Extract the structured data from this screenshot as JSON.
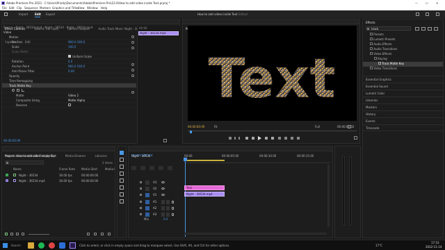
{
  "window": {
    "title": "Adobe Premiere Pro 2023 - C:\\Users\\Priody\\Documents\\Adobe\\Premiere Pro\\23.0\\How to add video inside Text.prproj *",
    "controls": [
      "—",
      "☐",
      "✕"
    ]
  },
  "menu": [
    "File",
    "Edit",
    "Clip",
    "Sequence",
    "Markers",
    "Graphics and Titles",
    "View",
    "Window",
    "Help"
  ],
  "workspace": {
    "tabs": [
      "Import",
      "Edit",
      "Export"
    ],
    "active": "Edit",
    "project_name": "How to add video inside Text",
    "edited_label": "Edited"
  },
  "source_panel": {
    "tabs": [
      "Effect Controls",
      "Source: (no clips)",
      "Lumetri Scopes",
      "Audio Track Mixer: Night - 36534",
      "Text",
      "Capture",
      "Edit"
    ],
    "header": "Source · Night - 36534.mp4 › Night - 36534 · Night - 36534.mp4",
    "section": "Video",
    "props": [
      {
        "name": "Motion",
        "value": ""
      },
      {
        "name": "Position",
        "value": "960.0   540.0"
      },
      {
        "name": "Scale",
        "value": "100.0"
      },
      {
        "name": "Scale Width",
        "value": ""
      },
      {
        "name": "",
        "value": "Uniform Scale"
      },
      {
        "name": "Rotation",
        "value": "0.0"
      },
      {
        "name": "Anchor Point",
        "value": "960.0   540.0"
      },
      {
        "name": "Anti-flicker Filter",
        "value": "0.00"
      },
      {
        "name": "Opacity",
        "value": ""
      },
      {
        "name": "Time Remapping",
        "value": ""
      },
      {
        "name": "Track Matte Key",
        "value": ""
      },
      {
        "name": "",
        "value": ""
      },
      {
        "name": "Matte",
        "value": "Video 2"
      },
      {
        "name": "Composite Using",
        "value": "Matte Alpha"
      },
      {
        "name": "Reverse",
        "value": ""
      }
    ],
    "mini_timeline_label": "00:00",
    "mini_clip": "Night - 36534.mp4",
    "timecode": "00:00:00:09"
  },
  "program": {
    "tabs": [
      "Program: Night - 36534",
      "Reference: Night - 36534",
      "Effects"
    ],
    "overlay_text": "Text",
    "timecode": "00:00:00:09",
    "fit": "Fit",
    "quality": "Full",
    "duration": "00:00:03:02"
  },
  "effects_panel": {
    "title": "Effects",
    "search": "track",
    "tree": [
      {
        "label": "Presets",
        "depth": 1
      },
      {
        "label": "Lumetri Presets",
        "depth": 1
      },
      {
        "label": "Audio Effects",
        "depth": 1
      },
      {
        "label": "Audio Transitions",
        "depth": 1
      },
      {
        "label": "Video Effects",
        "depth": 1
      },
      {
        "label": "Keying",
        "depth": 2
      },
      {
        "label": "Track Matte Key",
        "depth": 3
      },
      {
        "label": "Video Transitions",
        "depth": 1
      }
    ],
    "sections": [
      "Essential Graphics",
      "Essential Sound",
      "Lumetri Color",
      "Libraries",
      "Markers",
      "History",
      "Events",
      "Timecode"
    ]
  },
  "project_panel": {
    "tabs": [
      "Project: How to add video inside Text",
      "Media Browser",
      "Libraries"
    ],
    "path": "How to add video inside Text.prproj",
    "items_count": "2 items",
    "columns": [
      "Name",
      "Frame Rate",
      "Media Start",
      "Media E"
    ],
    "rows": [
      {
        "name": "Night - 36534",
        "fps": "30.00 fps",
        "start": "00:00:00:00",
        "color": "#3aa655"
      },
      {
        "name": "Night - 36534.mp4",
        "fps": "30.00 fps",
        "start": "00:00:00:00",
        "color": "#8d7ad9"
      }
    ]
  },
  "timeline": {
    "tab": "Night - 36534",
    "timecode": "00:00:00:09",
    "ruler": [
      "00:00",
      "00:00:05:00",
      "00:00:10:00",
      "00:00:15:00"
    ],
    "tracks_video": [
      "V3",
      "V2",
      "V1"
    ],
    "tracks_audio": [
      "A1",
      "A2",
      "A3"
    ],
    "mix": "Mix",
    "mix_value": "0.0",
    "clip_text": "Text",
    "clip_video": "Night - 36534.mp4"
  },
  "taskbar": {
    "search": "Search",
    "weather": "17°C",
    "time": "17:53",
    "date": "2022-11-14"
  },
  "status": "Click to select, or click in empty space and drag to marquee select. Use Shift, Alt, and Ctrl for other options."
}
